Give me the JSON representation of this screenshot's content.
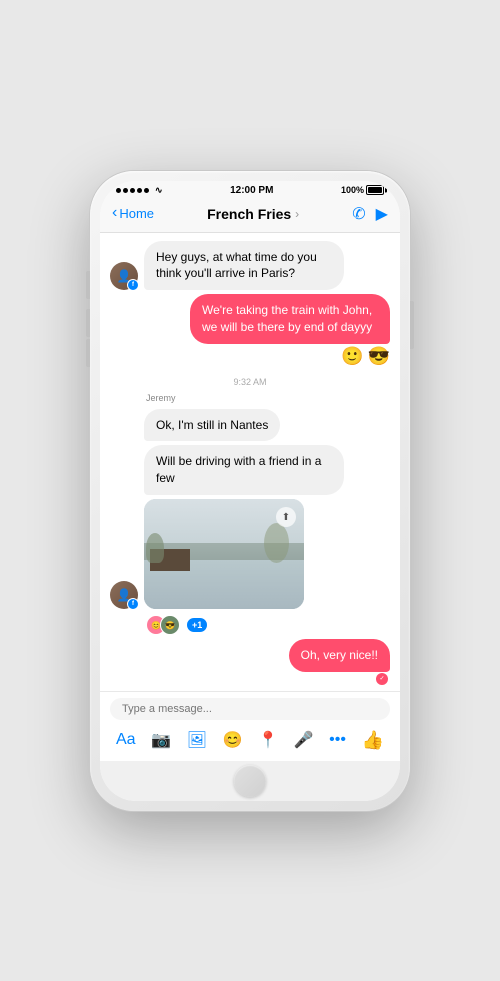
{
  "phone": {
    "status_bar": {
      "signal": "•••••",
      "time": "12:00 PM",
      "battery": "100%"
    },
    "nav": {
      "back_label": "Home",
      "title": "French Fries",
      "chevron": "›"
    },
    "messages": [
      {
        "id": "msg1",
        "type": "incoming",
        "avatar": true,
        "text": "Hey guys, at what time do you think you'll arrive in Paris?"
      },
      {
        "id": "msg2",
        "type": "outgoing",
        "text": "We're taking the train with John, we will be there by end of dayyy"
      },
      {
        "id": "msg3",
        "type": "timestamp",
        "text": "9:32 AM"
      },
      {
        "id": "msg4",
        "type": "sender_name",
        "text": "Jeremy"
      },
      {
        "id": "msg5",
        "type": "incoming",
        "avatar": false,
        "text": "Ok, I'm still in Nantes"
      },
      {
        "id": "msg6",
        "type": "incoming",
        "avatar": false,
        "text": "Will be driving with a friend in a few"
      },
      {
        "id": "msg7",
        "type": "incoming_photo",
        "avatar": true
      },
      {
        "id": "msg8",
        "type": "outgoing",
        "text": "Oh, very nice!!"
      }
    ],
    "input": {
      "placeholder": "Type a message..."
    },
    "toolbar": {
      "icons": [
        "Aa",
        "📷",
        "🖼",
        "😊",
        "📍",
        "🎤",
        "•••",
        "👍"
      ]
    },
    "reaction": {
      "plus_label": "+1"
    }
  }
}
